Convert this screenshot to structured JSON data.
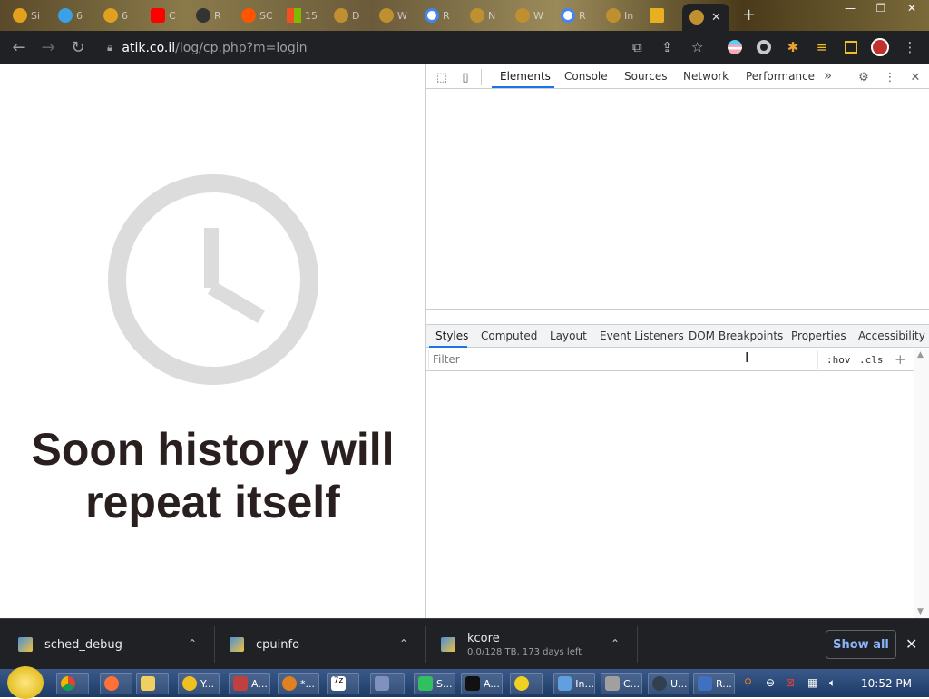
{
  "browser": {
    "tabs": [
      {
        "text": "Si",
        "color": "#e4a11b"
      },
      {
        "text": "6",
        "color": "#3aa0e8"
      },
      {
        "text": "6",
        "color": "#e0a020"
      },
      {
        "text": "C",
        "color": "#ff0000"
      },
      {
        "text": "R",
        "color": "#333333"
      },
      {
        "text": "SC",
        "color": "#ff5500"
      },
      {
        "text": "15",
        "color": "#00a2ed"
      },
      {
        "text": "D",
        "color": "#c09030"
      },
      {
        "text": "W",
        "color": "#c09030"
      },
      {
        "text": "R",
        "color": "#4285f4"
      },
      {
        "text": "N",
        "color": "#c09030"
      },
      {
        "text": "W",
        "color": "#c09030"
      },
      {
        "text": "R",
        "color": "#4285f4"
      },
      {
        "text": "In",
        "color": "#c09030"
      },
      {
        "text": "",
        "color": "#e8b020"
      }
    ],
    "active_tab_close": "✕",
    "new_tab": "+",
    "window_controls": [
      "—",
      "❐",
      "✕"
    ],
    "url_host": "atik.co.il",
    "url_path": "/log/cp.php?m=login"
  },
  "page": {
    "headline_line1": "Soon history will",
    "headline_line2": "repeat itself",
    "clock_color": "#dcdcdc"
  },
  "devtools": {
    "tabs": [
      "Elements",
      "Console",
      "Sources",
      "Network",
      "Performance"
    ],
    "more": "»",
    "sidebar_tabs": [
      "Styles",
      "Computed",
      "Layout",
      "Event Listeners",
      "DOM Breakpoints",
      "Properties",
      "Accessibility"
    ],
    "filter_placeholder": "Filter",
    "hov": ":hov",
    "cls": ".cls",
    "add": "+"
  },
  "downloads": {
    "items": [
      {
        "name": "sched_debug",
        "sub": ""
      },
      {
        "name": "cpuinfo",
        "sub": ""
      },
      {
        "name": "kcore",
        "sub": "0.0/128 TB, 173 days left"
      }
    ],
    "show_all": "Show all",
    "close": "✕"
  },
  "taskbar": {
    "buttons": [
      "",
      "",
      "",
      "Y...",
      "A...",
      "*...",
      "7z",
      "",
      "S...",
      "A...",
      "",
      "In...",
      "C...",
      "U...",
      "R..."
    ],
    "time": "10:52 PM"
  }
}
